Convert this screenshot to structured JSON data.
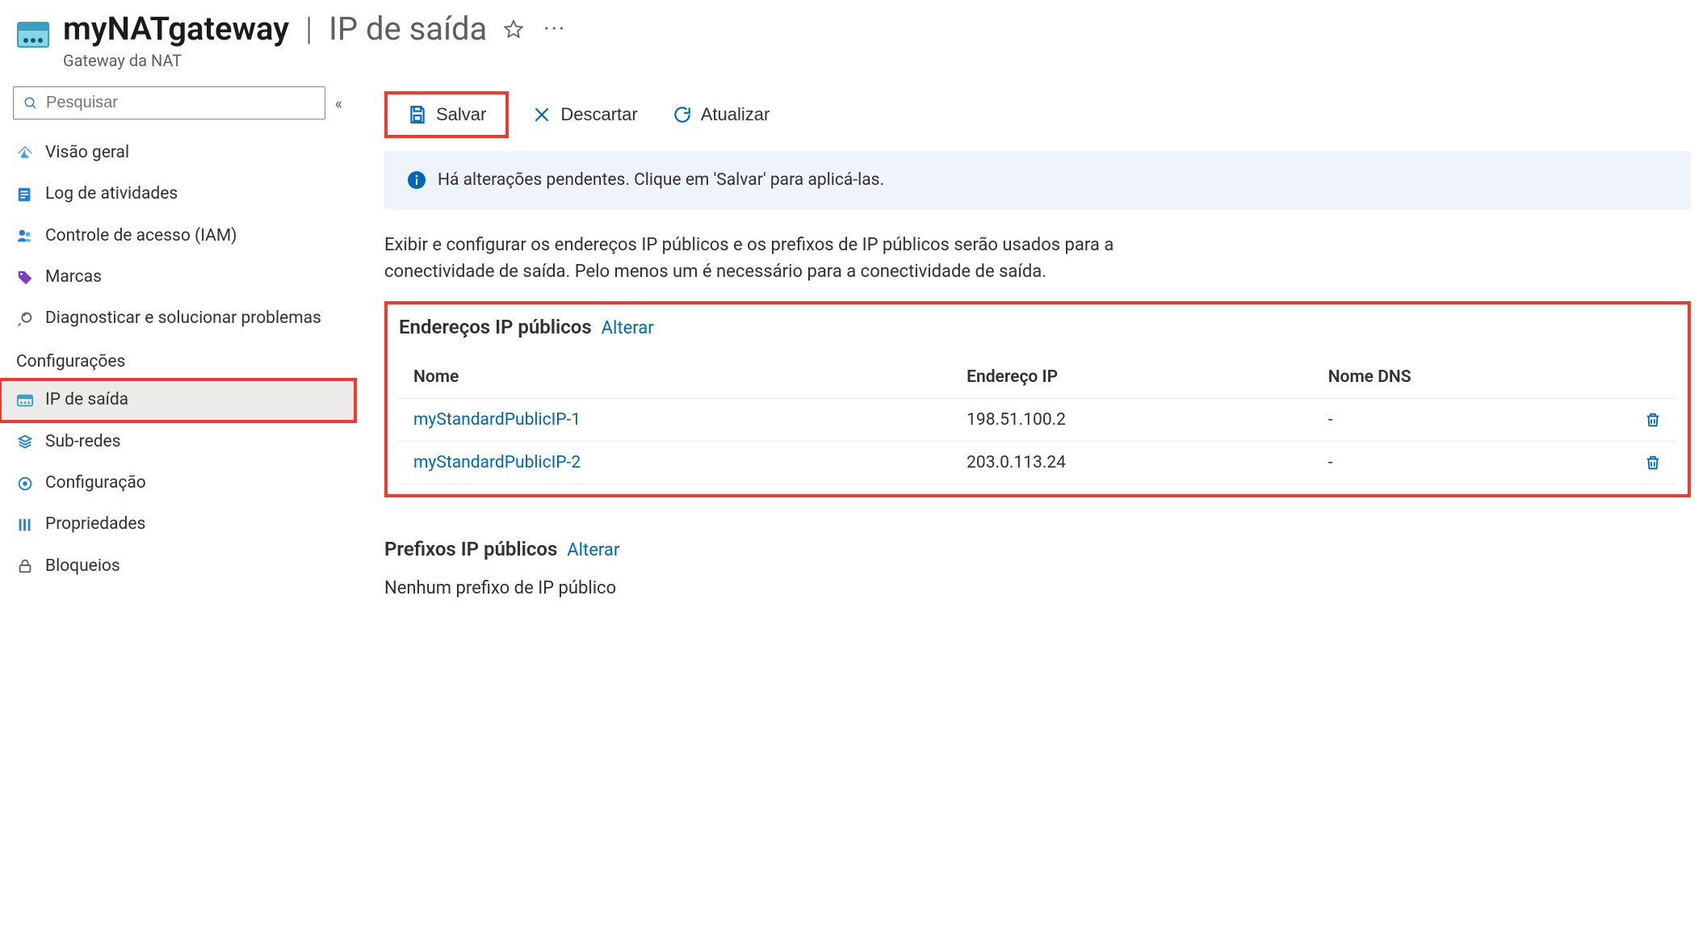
{
  "header": {
    "resource_name": "myNATgateway",
    "section": "IP de saída",
    "resource_type": "Gateway da NAT"
  },
  "sidebar": {
    "search_placeholder": "Pesquisar",
    "items_top": [
      {
        "key": "overview",
        "label": "Visão geral"
      },
      {
        "key": "activity-log",
        "label": "Log de atividades"
      },
      {
        "key": "iam",
        "label": "Controle de acesso (IAM)"
      },
      {
        "key": "tags",
        "label": "Marcas"
      },
      {
        "key": "diagnose",
        "label": "Diagnosticar e solucionar problemas"
      }
    ],
    "group_settings": "Configurações",
    "items_settings": [
      {
        "key": "outbound-ip",
        "label": "IP de saída",
        "selected": true
      },
      {
        "key": "subnets",
        "label": "Sub-redes"
      },
      {
        "key": "configuration",
        "label": "Configuração"
      },
      {
        "key": "properties",
        "label": "Propriedades"
      },
      {
        "key": "locks",
        "label": "Bloqueios"
      }
    ]
  },
  "toolbar": {
    "save": "Salvar",
    "discard": "Descartar",
    "refresh": "Atualizar"
  },
  "banner": {
    "text": "Há alterações pendentes. Clique em 'Salvar' para aplicá-las."
  },
  "description": "Exibir e configurar os endereços IP públicos e os prefixos de IP públicos serão usados para a conectividade de saída. Pelo menos um é necessário para a conectividade de saída.",
  "public_ips": {
    "title": "Endereços IP públicos",
    "change": "Alterar",
    "columns": {
      "name": "Nome",
      "ip": "Endereço IP",
      "dns": "Nome DNS"
    },
    "rows": [
      {
        "name": "myStandardPublicIP-1",
        "ip": "198.51.100.2",
        "dns": "-"
      },
      {
        "name": "myStandardPublicIP-2",
        "ip": "203.0.113.24",
        "dns": "-"
      }
    ]
  },
  "prefixes": {
    "title": "Prefixos IP públicos",
    "change": "Alterar",
    "empty": "Nenhum prefixo de IP público"
  }
}
